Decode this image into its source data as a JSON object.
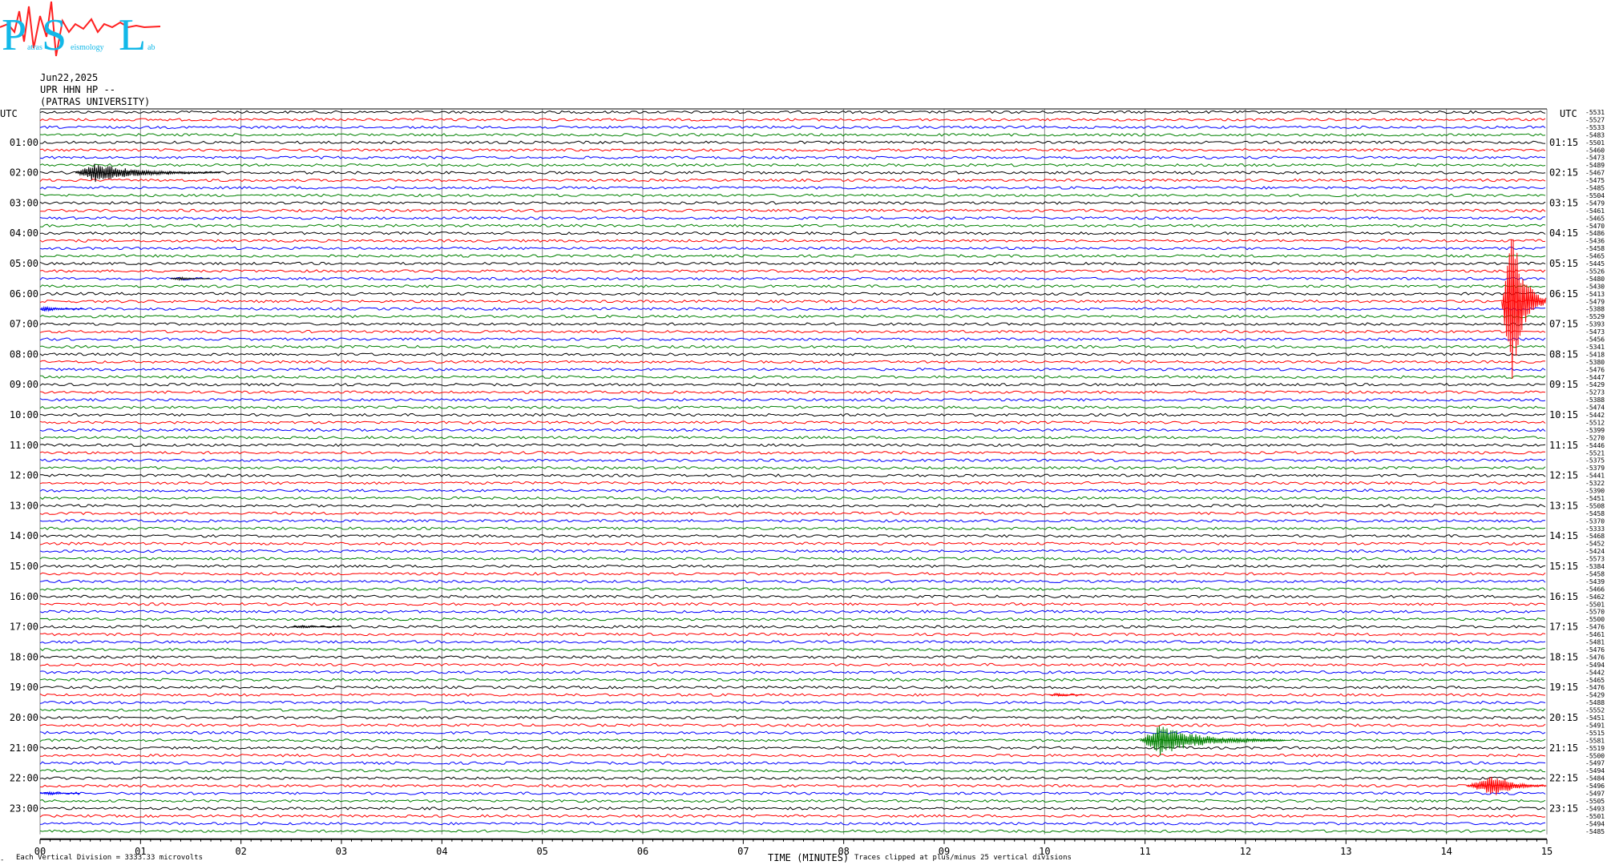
{
  "logo": {
    "big_letters": [
      "P",
      "S",
      "L"
    ],
    "small_text": [
      "atras",
      "eismology",
      "ab"
    ]
  },
  "header": {
    "date": "Jun22,2025",
    "station": "UPR HHN HP --",
    "institution": "(PATRAS UNIVERSITY)"
  },
  "left_axis": {
    "top_label": "UTC",
    "hour_labels": [
      "01:00",
      "02:00",
      "03:00",
      "04:00",
      "05:00",
      "06:00",
      "07:00",
      "08:00",
      "09:00",
      "10:00",
      "11:00",
      "12:00",
      "13:00",
      "14:00",
      "15:00",
      "16:00",
      "17:00",
      "18:00",
      "19:00",
      "20:00",
      "21:00",
      "22:00",
      "23:00"
    ]
  },
  "right_axis": {
    "top_label": "UTC",
    "hour_labels": [
      "01:15",
      "02:15",
      "03:15",
      "04:15",
      "05:15",
      "06:15",
      "07:15",
      "08:15",
      "09:15",
      "10:15",
      "11:15",
      "12:15",
      "13:15",
      "14:15",
      "15:15",
      "16:15",
      "17:15",
      "18:15",
      "19:15",
      "20:15",
      "21:15",
      "22:15",
      "23:15"
    ]
  },
  "offsets": [
    "-5531",
    "-5527",
    "-5533",
    "-5483",
    "-5501",
    "-5460",
    "-5473",
    "-5489",
    "-5467",
    "-5475",
    "-5485",
    "-5504",
    "-5479",
    "-5461",
    "-5465",
    "-5470",
    "-5486",
    "-5436",
    "-5458",
    "-5465",
    "-5445",
    "-5526",
    "-5480",
    "-5430",
    "-5413",
    "-5479",
    "-5388",
    "-5529",
    "-5393",
    "-5473",
    "-5456",
    "-5341",
    "-5418",
    "-5380",
    "-5476",
    "-5447",
    "-5429",
    "-5273",
    "-5388",
    "-5474",
    "-5442",
    "-5512",
    "-5399",
    "-5270",
    "-5446",
    "-5521",
    "-5375",
    "-5379",
    "-5441",
    "-5322",
    "-5390",
    "-5451",
    "-5508",
    "-5458",
    "-5370",
    "-5333",
    "-5468",
    "-5452",
    "-5424",
    "-5573",
    "-5384",
    "-5458",
    "-5439",
    "-5466",
    "-5462",
    "-5501",
    "-5570",
    "-5500",
    "-5476",
    "-5461",
    "-5481",
    "-5476",
    "-5476",
    "-5494",
    "-5442",
    "-5465",
    "-5476",
    "-5429",
    "-5488",
    "-5552",
    "-5451",
    "-5491",
    "-5515",
    "-5581",
    "-5519",
    "-5500",
    "-5497",
    "-5494",
    "-5484",
    "-5496",
    "-5497",
    "-5505",
    "-5493",
    "-5501",
    "-5494",
    "-5485"
  ],
  "x_axis": {
    "tick_labels": [
      "00",
      "01",
      "02",
      "03",
      "04",
      "05",
      "06",
      "07",
      "08",
      "09",
      "10",
      "11",
      "12",
      "13",
      "14",
      "15"
    ],
    "title": "TIME (MINUTES)"
  },
  "footer": {
    "left_mark": "-",
    "vertical_division": "Each Vertical Division = 3333.33 microvolts",
    "clip_note": "Traces clipped at plus/minus 25 vertical divisions"
  },
  "chart_data": {
    "type": "line",
    "title": "",
    "xlabel": "TIME (MINUTES)",
    "ylabel": "UTC",
    "xlim": [
      0,
      15
    ],
    "rows_per_hour": 4,
    "row_count": 96,
    "trace_colors": [
      "#000000",
      "#ff0000",
      "#0000ff",
      "#008000"
    ],
    "gridlines": true,
    "events": [
      {
        "row": 8,
        "start_min": 0.35,
        "peak_min": 0.55,
        "end_min": 1.8,
        "peak_divisions": 2.8,
        "color": "#000000"
      },
      {
        "row": 22,
        "start_min": 1.3,
        "peak_min": 1.4,
        "end_min": 1.7,
        "peak_divisions": 0.5,
        "color": "#000000"
      },
      {
        "row": 25,
        "start_min": 14.55,
        "peak_min": 14.65,
        "end_min": 15.0,
        "peak_divisions": 25,
        "color": "#ff0000"
      },
      {
        "row": 26,
        "start_min": 0.0,
        "peak_min": 0.05,
        "end_min": 0.45,
        "peak_divisions": 0.8,
        "color": "#0000ff"
      },
      {
        "row": 68,
        "start_min": 2.5,
        "peak_min": 2.6,
        "end_min": 3.0,
        "peak_divisions": 0.4,
        "color": "#000000"
      },
      {
        "row": 77,
        "start_min": 10.05,
        "peak_min": 10.15,
        "end_min": 10.4,
        "peak_divisions": 0.4,
        "color": "#ff0000"
      },
      {
        "row": 83,
        "start_min": 10.95,
        "peak_min": 11.15,
        "end_min": 12.4,
        "peak_divisions": 4.5,
        "color": "#008000"
      },
      {
        "row": 89,
        "start_min": 14.2,
        "peak_min": 14.5,
        "end_min": 15.0,
        "peak_divisions": 3.3,
        "color": "#ff0000"
      },
      {
        "row": 90,
        "start_min": 0.0,
        "peak_min": 0.1,
        "end_min": 0.4,
        "peak_divisions": 0.5,
        "color": "#0000ff"
      }
    ]
  }
}
